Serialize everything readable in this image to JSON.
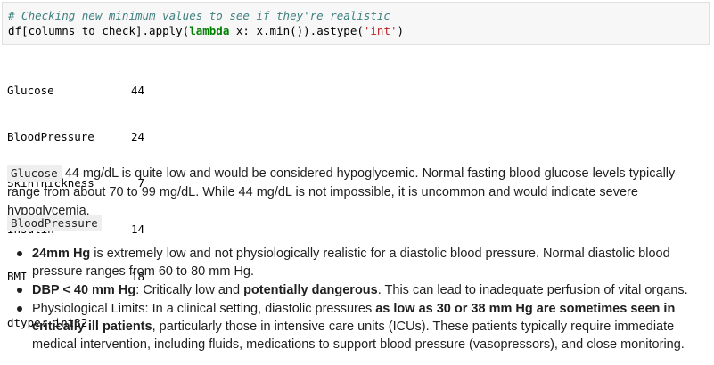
{
  "code_cell": {
    "comment": "# Checking new minimum values to see if they're realistic",
    "line2_part1": "df[columns_to_check].apply(",
    "line2_keyword": "lambda",
    "line2_part2": " x: x.min()).astype(",
    "line2_string": "'int'",
    "line2_part3": ")"
  },
  "output": {
    "rows": [
      {
        "name": "Glucose",
        "value": "44"
      },
      {
        "name": "BloodPressure",
        "value": "24"
      },
      {
        "name": "SkinThickness",
        "value": "7"
      },
      {
        "name": "Insulin",
        "value": "14"
      },
      {
        "name": "BMI",
        "value": "18"
      }
    ],
    "dtype": "dtype: int32"
  },
  "markdown": {
    "glucose_code": "Glucose",
    "glucose_text": " 44 mg/dL is quite low and would be considered hypoglycemic. Normal fasting blood glucose levels typically range from about 70 to 99 mg/dL. While 44 mg/dL is not impossible, it is uncommon and would indicate severe hypoglycemia.",
    "bp_code": "BloodPressure",
    "bullets": [
      {
        "bold1": "24mm Hg",
        "text1": " is extremely low and not physiologically realistic for a diastolic blood pressure. Normal diastolic blood pressure ranges from 60 to 80 mm Hg."
      },
      {
        "bold1": "DBP < 40 mm Hg",
        "text1": ": Critically low and ",
        "bold2": "potentially dangerous",
        "text2": ". This can lead to inadequate perfusion of vital organs."
      },
      {
        "text0": "Physiological Limits: In a clinical setting, diastolic pressures ",
        "bold1": "as low as 30 or 38 mm Hg are sometimes seen in critically ill patients",
        "text1": ", particularly those in intensive care units (ICUs). These patients typically require immediate medical intervention, including fluids, medications to support blood pressure (vasopressors), and close monitoring."
      }
    ]
  }
}
